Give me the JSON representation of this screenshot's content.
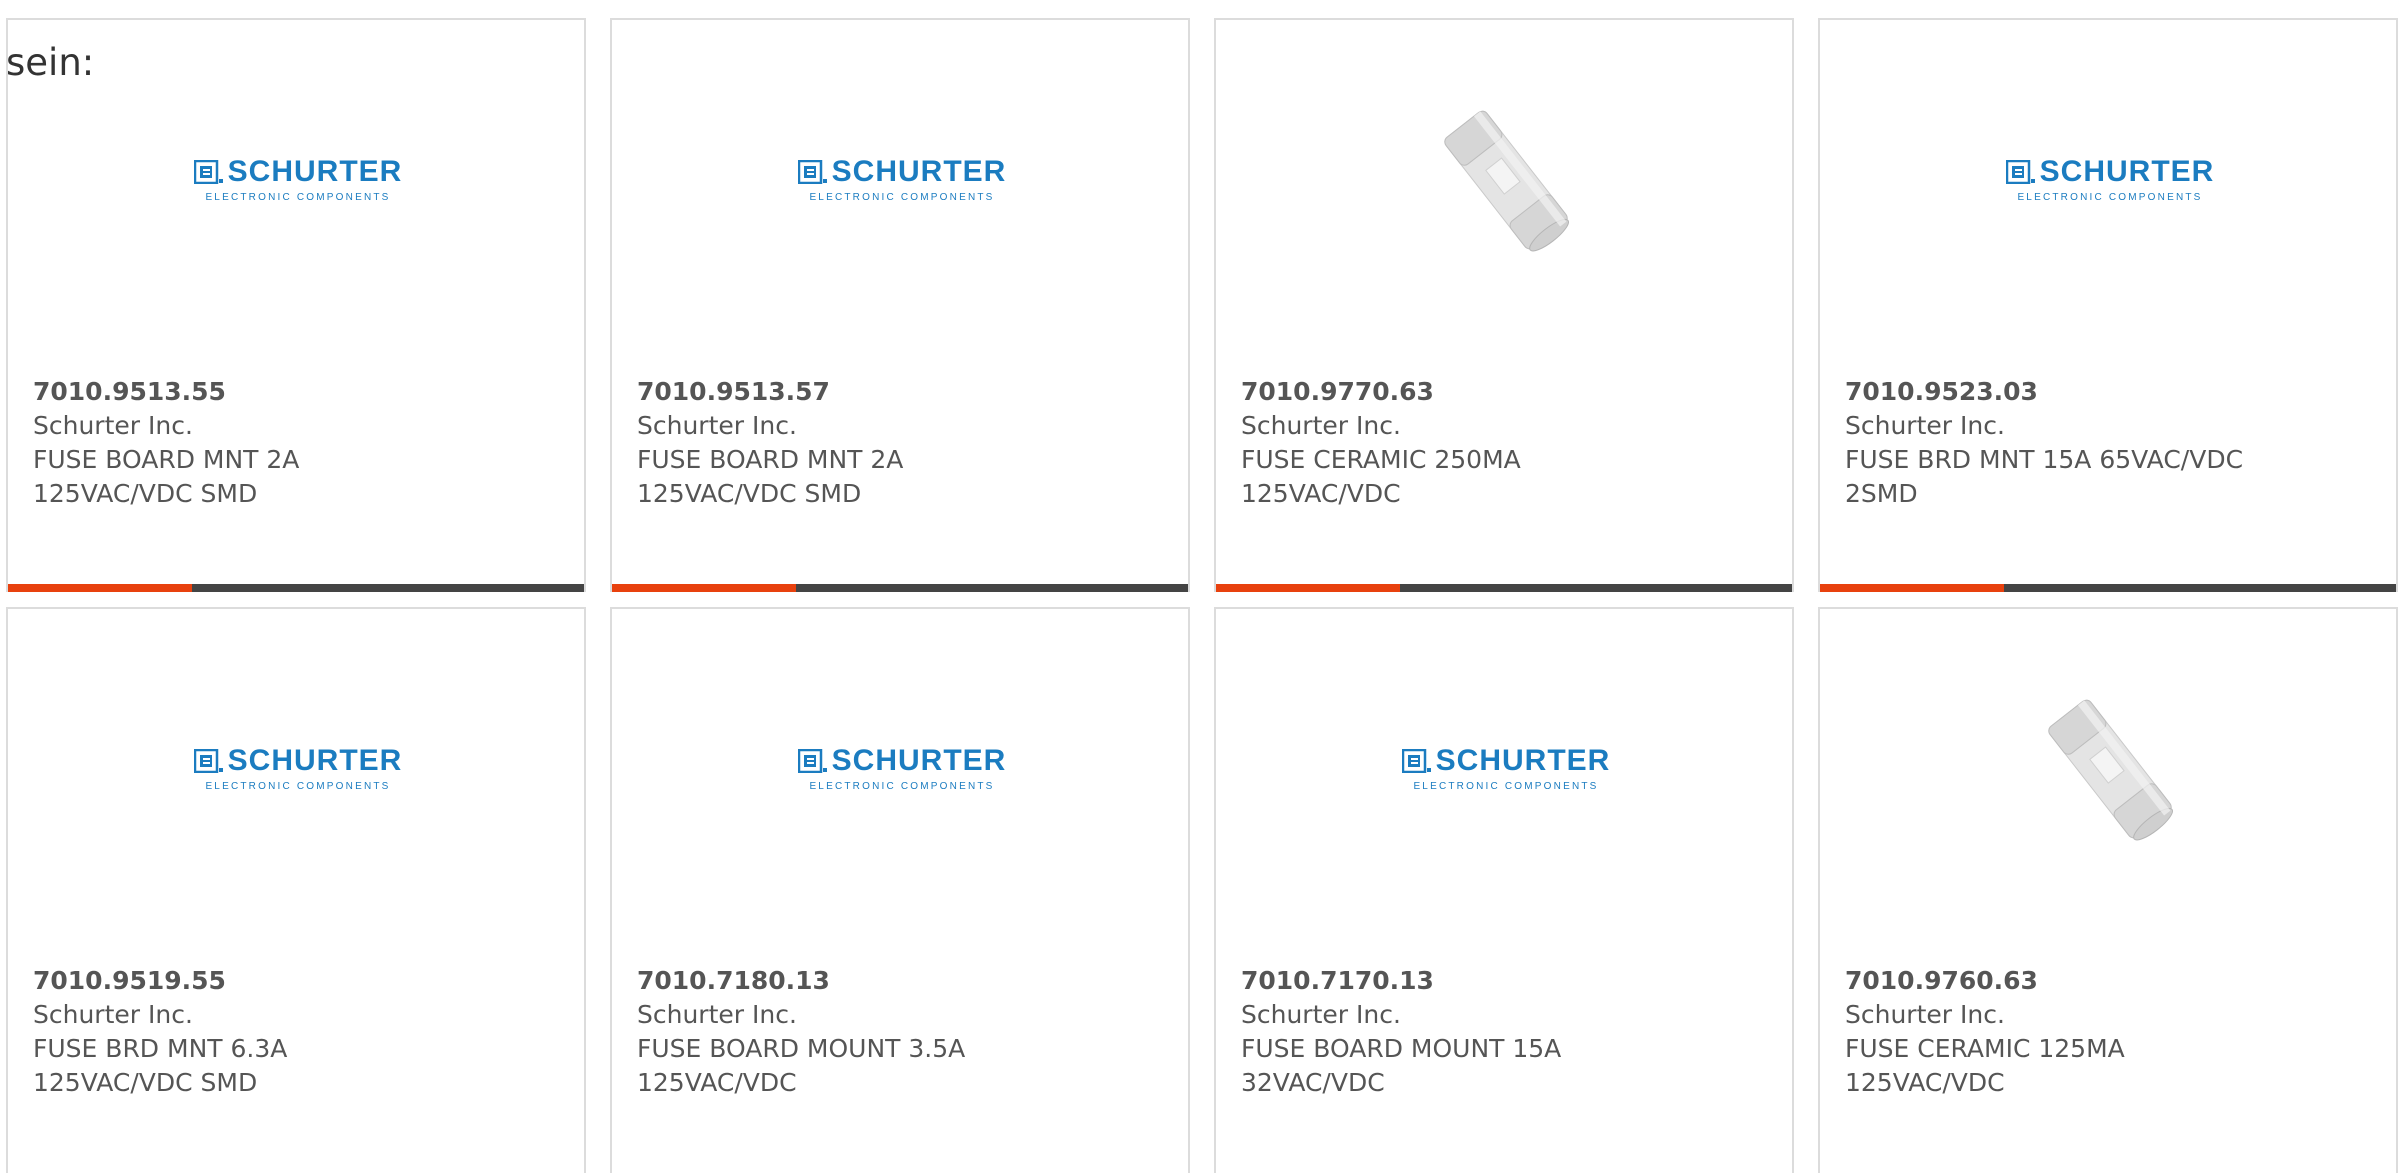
{
  "intro": {
    "text": "sein:"
  },
  "colors": {
    "accent": "#e8410e",
    "bar_dark": "#444444",
    "brand_blue": "#1b7cc0",
    "text": "#555555",
    "border": "#dcdcdc"
  },
  "logo": {
    "main": "SCHURTER",
    "sub": "ELECTRONIC COMPONENTS"
  },
  "products": [
    {
      "part_number": "7010.9513.55",
      "manufacturer": "Schurter Inc.",
      "description_line1": "FUSE BOARD MNT 2A",
      "description_line2": "125VAC/VDC SMD",
      "image": "schurter-logo"
    },
    {
      "part_number": "7010.9513.57",
      "manufacturer": "Schurter Inc.",
      "description_line1": "FUSE BOARD MNT 2A",
      "description_line2": "125VAC/VDC SMD",
      "image": "schurter-logo"
    },
    {
      "part_number": "7010.9770.63",
      "manufacturer": "Schurter Inc.",
      "description_line1": "FUSE CERAMIC 250MA",
      "description_line2": "125VAC/VDC",
      "image": "ceramic-fuse-photo"
    },
    {
      "part_number": "7010.9523.03",
      "manufacturer": "Schurter Inc.",
      "description_line1": "FUSE BRD MNT 15A 65VAC/VDC",
      "description_line2": "2SMD",
      "image": "schurter-logo"
    },
    {
      "part_number": "7010.9519.55",
      "manufacturer": "Schurter Inc.",
      "description_line1": "FUSE BRD MNT 6.3A",
      "description_line2": "125VAC/VDC SMD",
      "image": "schurter-logo"
    },
    {
      "part_number": "7010.7180.13",
      "manufacturer": "Schurter Inc.",
      "description_line1": "FUSE BOARD MOUNT 3.5A",
      "description_line2": "125VAC/VDC",
      "image": "schurter-logo"
    },
    {
      "part_number": "7010.7170.13",
      "manufacturer": "Schurter Inc.",
      "description_line1": "FUSE BOARD MOUNT 15A",
      "description_line2": "32VAC/VDC",
      "image": "schurter-logo"
    },
    {
      "part_number": "7010.9760.63",
      "manufacturer": "Schurter Inc.",
      "description_line1": "FUSE CERAMIC 125MA",
      "description_line2": "125VAC/VDC",
      "image": "ceramic-fuse-photo"
    }
  ]
}
